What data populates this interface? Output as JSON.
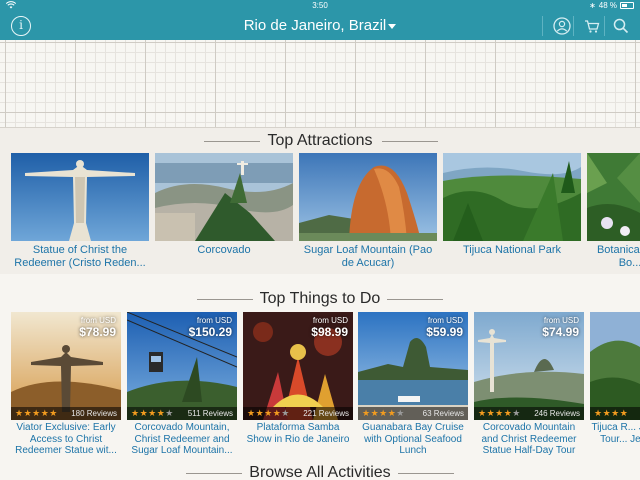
{
  "status": {
    "time": "3:50",
    "battery": "48 %"
  },
  "nav": {
    "title": "Rio de Janeiro, Brazil"
  },
  "sections": {
    "attractions": "Top Attractions",
    "todo": "Top Things to Do",
    "browse": "Browse All Activities"
  },
  "attractions": [
    {
      "name": "Statue of Christ the Redeemer (Cristo Reden..."
    },
    {
      "name": "Corcovado"
    },
    {
      "name": "Sugar Loaf Mountain (Pao de Acucar)"
    },
    {
      "name": "Tijuca National Park"
    },
    {
      "name": "Botanical G... Bo..."
    }
  ],
  "things_to_do": [
    {
      "from": "from USD",
      "price": "$78.99",
      "reviews": "180 Reviews",
      "rating": 4.5,
      "name": "Viator Exclusive: Early Access to Christ Redeemer Statue wit..."
    },
    {
      "from": "from USD",
      "price": "$150.29",
      "reviews": "511 Reviews",
      "rating": 4,
      "name": "Corcovado Mountain, Christ Redeemer and Sugar Loaf Mountain..."
    },
    {
      "from": "from USD",
      "price": "$98.99",
      "reviews": "221 Reviews",
      "rating": 4,
      "name": "Plataforma Samba Show in Rio de Janeiro"
    },
    {
      "from": "from USD",
      "price": "$59.99",
      "reviews": "63 Reviews",
      "rating": 4,
      "name": "Guanabara Bay Cruise with Optional Seafood Lunch"
    },
    {
      "from": "from USD",
      "price": "$74.99",
      "reviews": "246 Reviews",
      "rating": 4,
      "name": "Corcovado Mountain and Christ Redeemer Statue Half-Day Tour"
    },
    {
      "from": "",
      "price": "",
      "reviews": "",
      "rating": 4,
      "name": "Tijuca R... Jeep Tour... Jer..."
    }
  ],
  "colors": {
    "nav": "#2c96a9",
    "link": "#1d74a8",
    "star": "#f39c1f"
  }
}
